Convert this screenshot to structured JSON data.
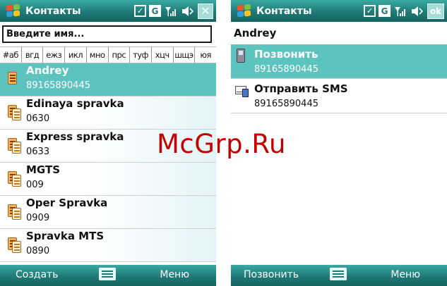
{
  "left_screen": {
    "title": "Контакты",
    "status_icons": [
      "checkbox-icon",
      "g-icon",
      "signal-icon",
      "volume-icon"
    ],
    "close_label": "✕",
    "search_placeholder": "Введите имя...",
    "alphabet": [
      "#аб",
      "вгд",
      "ежз",
      "икл",
      "мно",
      "прс",
      "туф",
      "хцч",
      "шщэ",
      "юя"
    ],
    "contacts": [
      {
        "name": "Andrey",
        "number": "89165890445",
        "selected": true
      },
      {
        "name": "Edinaya spravka",
        "number": "0630",
        "selected": false
      },
      {
        "name": "Express spravka",
        "number": "0633",
        "selected": false
      },
      {
        "name": "MGTS",
        "number": "009",
        "selected": false
      },
      {
        "name": "Oper Spravka",
        "number": "0909",
        "selected": false
      },
      {
        "name": "Spravka MTS",
        "number": "0890",
        "selected": false
      }
    ],
    "softkeys": {
      "left": "Создать",
      "right": "Меню"
    }
  },
  "right_screen": {
    "title": "Контакты",
    "ok_label": "ok",
    "contact_name": "Andrey",
    "actions": [
      {
        "label": "Позвонить",
        "number": "89165890445",
        "icon": "phone-icon",
        "selected": true
      },
      {
        "label": "Отправить SMS",
        "number": "89165890445",
        "icon": "sms-icon",
        "selected": false
      }
    ],
    "softkeys": {
      "left": "Позвонить",
      "right": "Меню"
    }
  },
  "watermark": "McGrp.Ru",
  "colors": {
    "titlebar": "#1f7a77",
    "selection": "#5cc3bf",
    "watermark": "#c40000"
  }
}
